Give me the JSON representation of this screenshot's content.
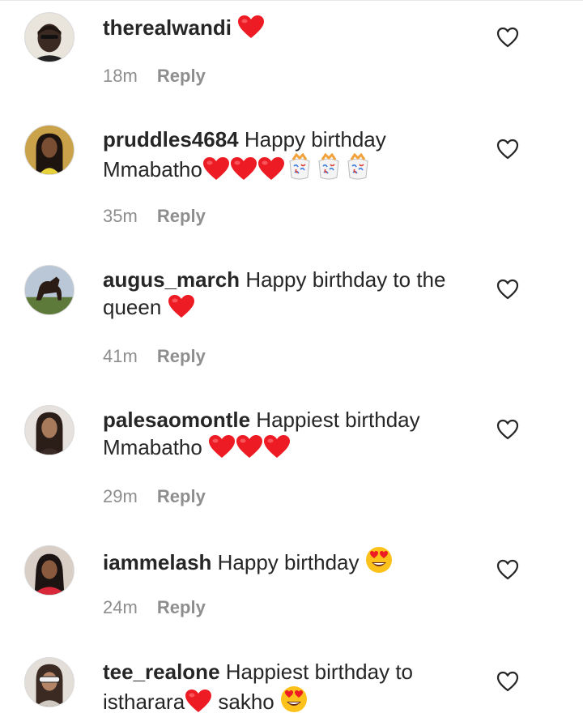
{
  "comments": [
    {
      "username": "therealwandi",
      "text": "",
      "emoji": [
        "red-heart"
      ],
      "time": "18m",
      "reply": "Reply"
    },
    {
      "username": "pruddles4684",
      "text": "Happy birthday Mmabatho",
      "emoji": [
        "red-heart",
        "red-heart",
        "red-heart",
        "confetti-ball",
        "confetti-ball",
        "confetti-ball"
      ],
      "time": "35m",
      "reply": "Reply"
    },
    {
      "username": "augus_march",
      "text": "Happy birthday to the queen",
      "emoji": [
        "red-heart"
      ],
      "time": "41m",
      "reply": "Reply"
    },
    {
      "username": "palesaomontle",
      "text": "Happiest birthday Mmabatho",
      "emoji": [
        "red-heart",
        "red-heart",
        "red-heart"
      ],
      "time": "29m",
      "reply": "Reply"
    },
    {
      "username": "iammelash",
      "text": "Happy birthday",
      "emoji": [
        "heart-eyes-face"
      ],
      "time": "24m",
      "reply": "Reply"
    },
    {
      "username": "tee_realone",
      "text_part1": "Happiest birthday to istharara",
      "text_part2": "sakho",
      "emoji": [
        "red-heart",
        "heart-eyes-face"
      ],
      "time": "",
      "reply": ""
    }
  ],
  "colors": {
    "text": "#262626",
    "meta": "#8e8e8e",
    "heart": "#ed1c24"
  },
  "icons": {
    "like": "heart-outline-icon"
  }
}
